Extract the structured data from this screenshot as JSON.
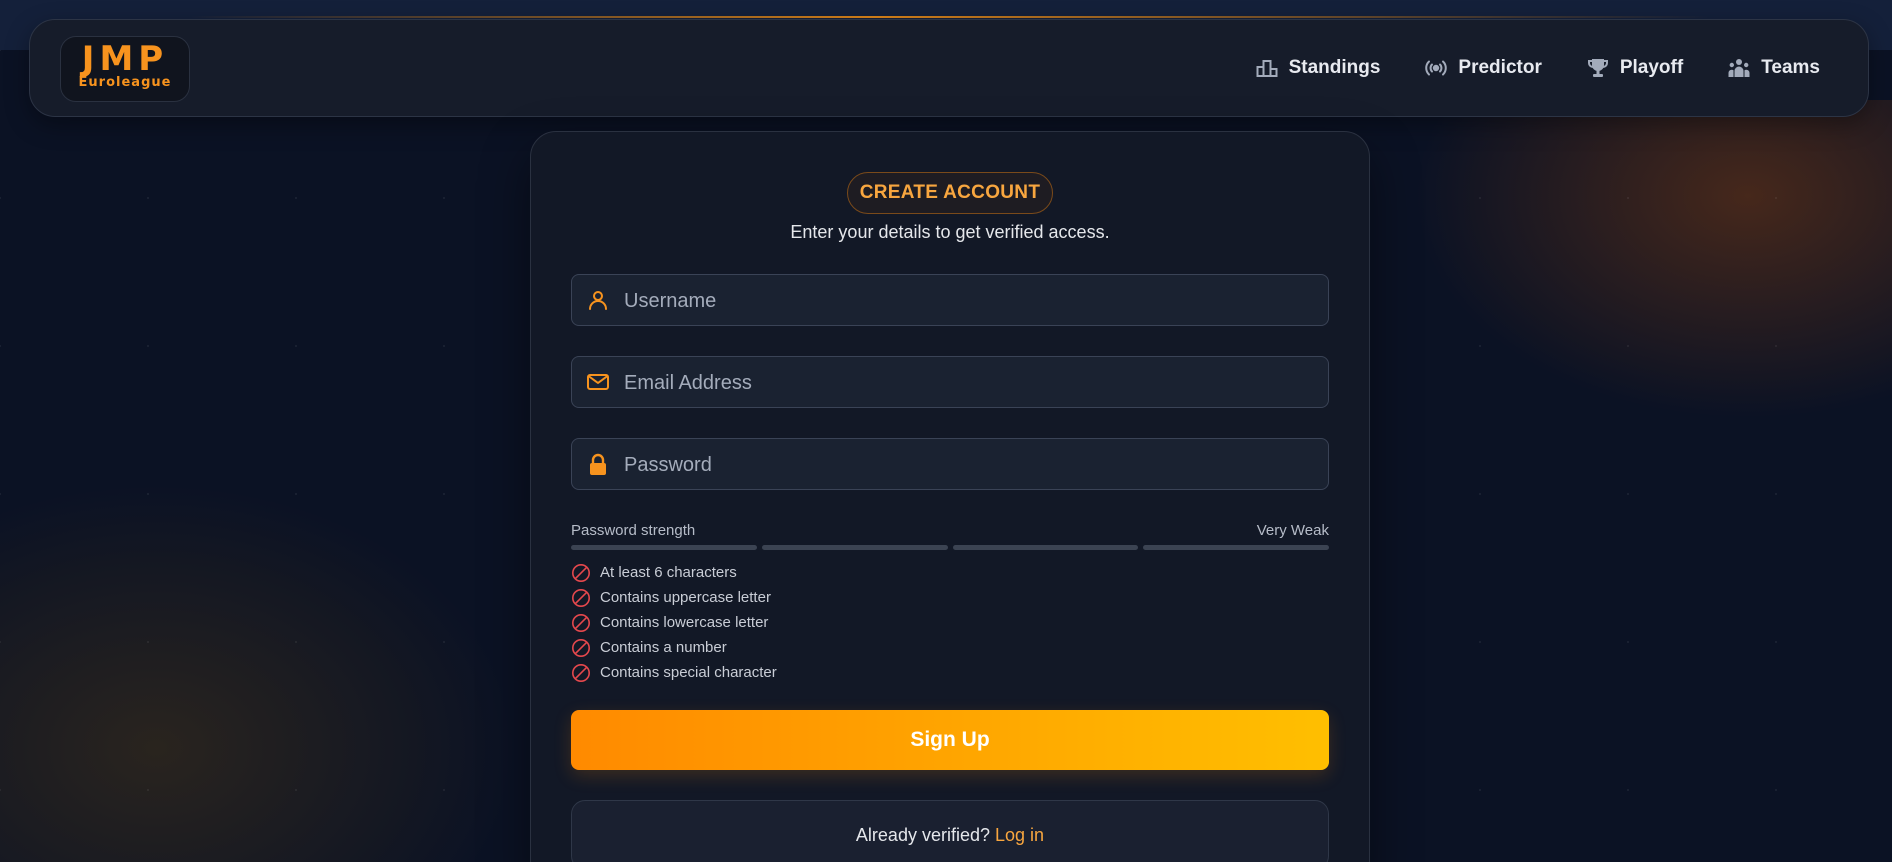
{
  "brand": {
    "logo_main": "JMP",
    "logo_sub": "Euroleague"
  },
  "nav": {
    "items": [
      {
        "label": "Standings",
        "icon": "podium-icon"
      },
      {
        "label": "Predictor",
        "icon": "broadcast-icon"
      },
      {
        "label": "Playoff",
        "icon": "trophy-icon"
      },
      {
        "label": "Teams",
        "icon": "team-icon"
      }
    ]
  },
  "form": {
    "badge": "CREATE ACCOUNT",
    "subtitle": "Enter your details to get verified access.",
    "username_placeholder": "Username",
    "email_placeholder": "Email Address",
    "password_placeholder": "Password",
    "strength_label": "Password strength",
    "strength_value": "Very Weak",
    "strength_segments_filled": 0,
    "strength_segments_total": 4,
    "requirements": [
      {
        "label": "At least 6 characters",
        "met": false
      },
      {
        "label": "Contains uppercase letter",
        "met": false
      },
      {
        "label": "Contains lowercase letter",
        "met": false
      },
      {
        "label": "Contains a number",
        "met": false
      },
      {
        "label": "Contains special character",
        "met": false
      }
    ],
    "submit_label": "Sign Up",
    "login_prompt": "Already verified?",
    "login_link": "Log in"
  },
  "colors": {
    "accent": "#f7931e",
    "button_gradient_start": "#ff8a00",
    "button_gradient_end": "#ffbf00",
    "requirement_unmet": "#e5484d",
    "background": "#0b1224"
  }
}
